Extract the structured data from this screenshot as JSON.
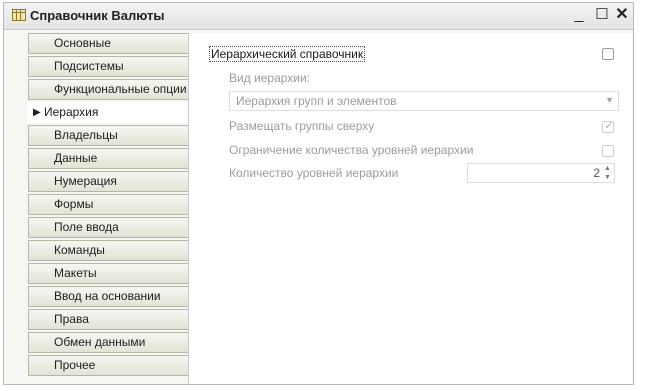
{
  "window": {
    "title": "Справочник Валюты",
    "icon": "catalog-table-icon",
    "controls": {
      "minimize": "_",
      "maximize": "☐",
      "close": "✕"
    }
  },
  "tabs": [
    {
      "label": "Основные"
    },
    {
      "label": "Подсистемы"
    },
    {
      "label": "Функциональные опции"
    },
    {
      "label": "Иерархия",
      "active": true
    },
    {
      "label": "Владельцы"
    },
    {
      "label": "Данные"
    },
    {
      "label": "Нумерация"
    },
    {
      "label": "Формы"
    },
    {
      "label": "Поле ввода"
    },
    {
      "label": "Команды"
    },
    {
      "label": "Макеты"
    },
    {
      "label": "Ввод на основании"
    },
    {
      "label": "Права"
    },
    {
      "label": "Обмен данными"
    },
    {
      "label": "Прочее"
    }
  ],
  "hierarchy": {
    "hierarchical_label": "Иерархический справочник",
    "hierarchical_checked": false,
    "type_label": "Вид иерархии:",
    "type_value": "Иерархия групп и элементов",
    "groups_on_top_label": "Размещать группы сверху",
    "groups_on_top_checked": true,
    "limit_levels_label": "Ограничение количества уровней иерархии",
    "limit_levels_checked": false,
    "levels_count_label": "Количество уровней иерархии",
    "levels_count_value": "2"
  },
  "colors": {
    "active_tab": "#ffffff",
    "inactive_tab": "#e9e8de",
    "disabled_text": "#9c9c9c"
  }
}
